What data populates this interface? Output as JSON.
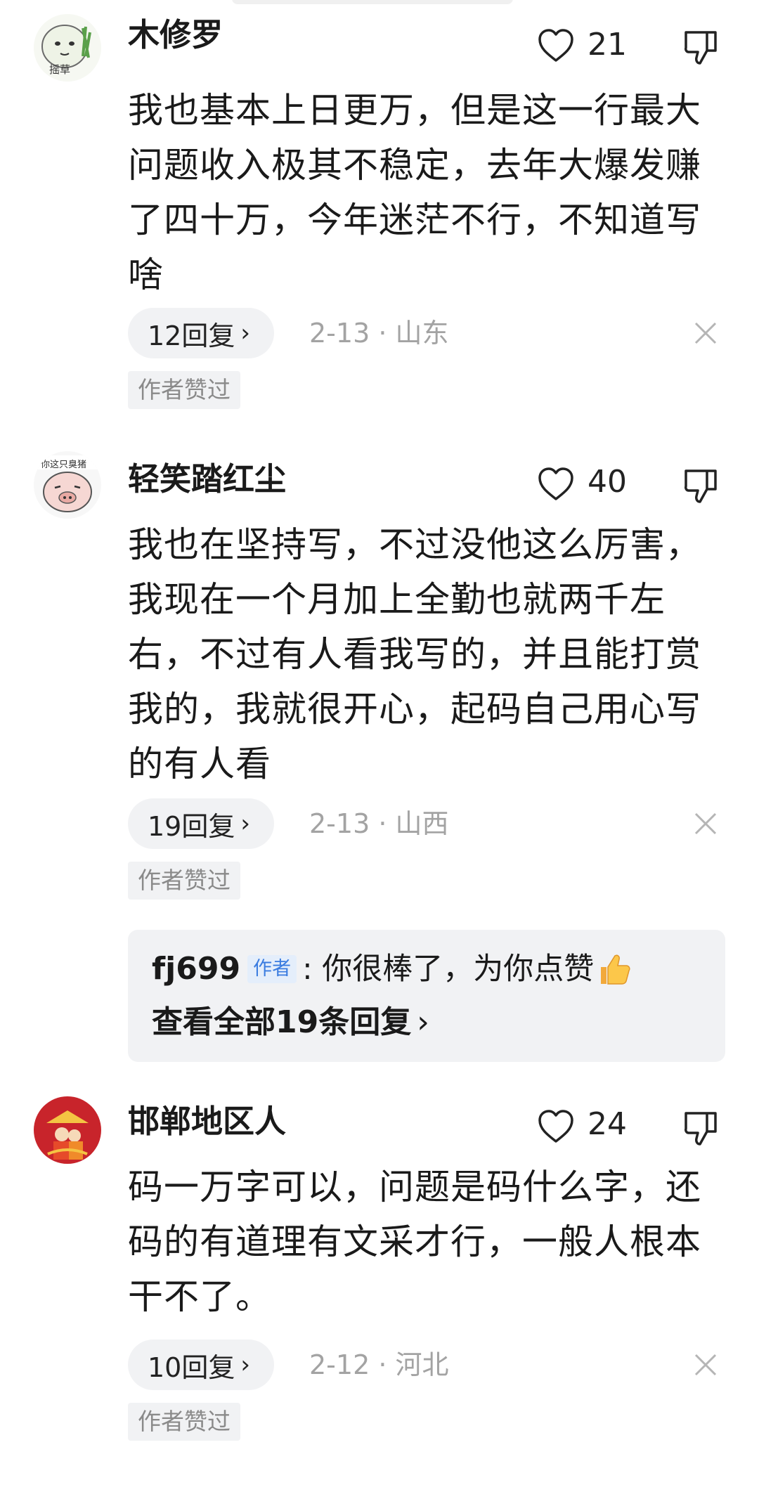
{
  "comments": [
    {
      "username": "木修罗",
      "avatar_label": "摇草",
      "likes": "21",
      "text": "我也基本上日更万，但是这一行最大问题收入极其不稳定，去年大爆发赚了四十万，今年迷茫不行，不知道写啥",
      "replies_label": "12回复",
      "meta": "2-13 · 山东",
      "badge": "作者赞过"
    },
    {
      "username": "轻笑踏红尘",
      "avatar_label": "你这只臭猪",
      "likes": "40",
      "text": "我也在坚持写，不过没他这么厉害，我现在一个月加上全勤也就两千左右，不过有人看我写的，并且能打赏我的，我就很开心，起码自己用心写的有人看",
      "replies_label": "19回复",
      "meta": "2-13 · 山西",
      "badge": "作者赞过",
      "author_reply": {
        "user": "fj699",
        "tag": "作者",
        "text": ": 你很棒了，为你点赞",
        "see_all": "查看全部19条回复"
      }
    },
    {
      "username": "邯郸地区人",
      "likes": "24",
      "text": "码一万字可以，问题是码什么字，还码的有道理有文采才行，一般人根本干不了。",
      "replies_label": "10回复",
      "meta": "2-12 · 河北",
      "badge": "作者赞过"
    }
  ],
  "icons": {
    "like": "heart-outline-icon",
    "dislike": "thumbs-down-icon",
    "close": "close-icon",
    "chevron": "chevron-right-icon",
    "thumb": "thumbs-up-emoji-icon"
  },
  "colors": {
    "meta_gray": "#a3a3a3",
    "pill_bg": "#f1f2f4",
    "author_tag": "#3a7ce0"
  }
}
